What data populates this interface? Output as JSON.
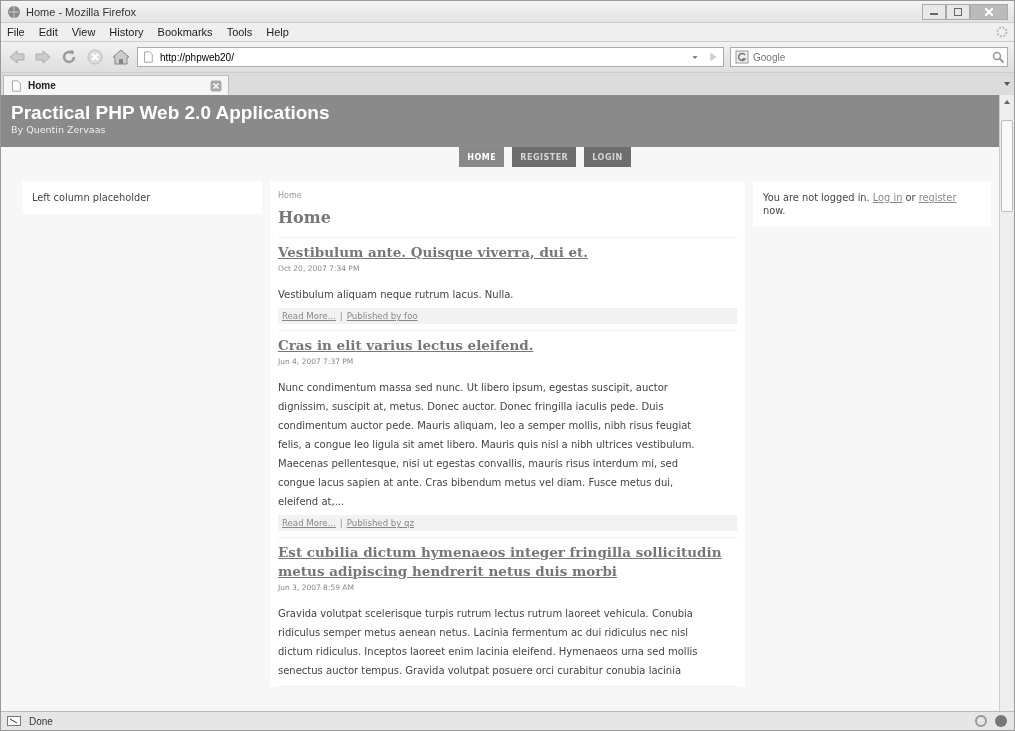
{
  "window": {
    "title": "Home - Mozilla Firefox"
  },
  "menu": [
    "File",
    "Edit",
    "View",
    "History",
    "Bookmarks",
    "Tools",
    "Help"
  ],
  "address": {
    "value": "http://phpweb20/"
  },
  "search": {
    "placeholder": "Google"
  },
  "tabs": [
    {
      "label": "Home",
      "selected": true
    }
  ],
  "site": {
    "title": "Practical PHP Web 2.0 Applications",
    "subtitle": "By Quentin Zervaas"
  },
  "nav": [
    {
      "label": "HOME",
      "selected": true
    },
    {
      "label": "REGISTER",
      "selected": false
    },
    {
      "label": "LOGIN",
      "selected": false
    }
  ],
  "left_column": {
    "text": "Left column placeholder"
  },
  "breadcrumb": "Home",
  "heading": "Home",
  "posts": [
    {
      "title": "Vestibulum ante. Quisque viverra, dui et.",
      "date": "Oct 20, 2007 7:34 PM",
      "body": "Vestibulum aliquam neque rutrum lacus. Nulla.",
      "read_more": "Read More...",
      "separator": "|",
      "published": "Published by foo"
    },
    {
      "title": "Cras in elit varius lectus eleifend.",
      "date": "Jun 4, 2007 7:37 PM",
      "body": "Nunc condimentum massa sed nunc. Ut libero ipsum, egestas suscipit, auctor dignissim, suscipit at, metus. Donec auctor. Donec fringilla iaculis pede. Duis condimentum auctor pede. Mauris aliquam, leo a semper mollis, nibh risus feugiat felis, a congue leo ligula sit amet libero. Mauris quis nisl a nibh ultrices vestibulum. Maecenas pellentesque, nisi ut egestas convallis, mauris risus interdum mi, sed congue lacus sapien at ante. Cras bibendum metus vel diam. Fusce metus dui, eleifend at,...",
      "read_more": "Read More...",
      "separator": "|",
      "published": "Published by qz"
    },
    {
      "title": "Est cubilia dictum hymenaeos integer fringilla sollicitudin metus adipiscing hendrerit netus duis morbi",
      "date": "Jun 3, 2007 8:59 AM",
      "body": "Gravida volutpat scelerisque turpis rutrum lectus rutrum laoreet vehicula. Conubia ridiculus semper metus aenean netus. Lacinia fermentum ac dui ridiculus nec nisl dictum ridiculus. Inceptos laoreet enim lacinia eleifend. Hymenaeos urna sed mollis senectus auctor tempus. Gravida volutpat posuere orci curabitur conubia lacinia"
    }
  ],
  "login_box": {
    "before": "You are not logged in.",
    "login_link": "Log in",
    "middle": "or",
    "register_link": "register",
    "after": "now."
  },
  "status_bar": {
    "text": "Done"
  }
}
